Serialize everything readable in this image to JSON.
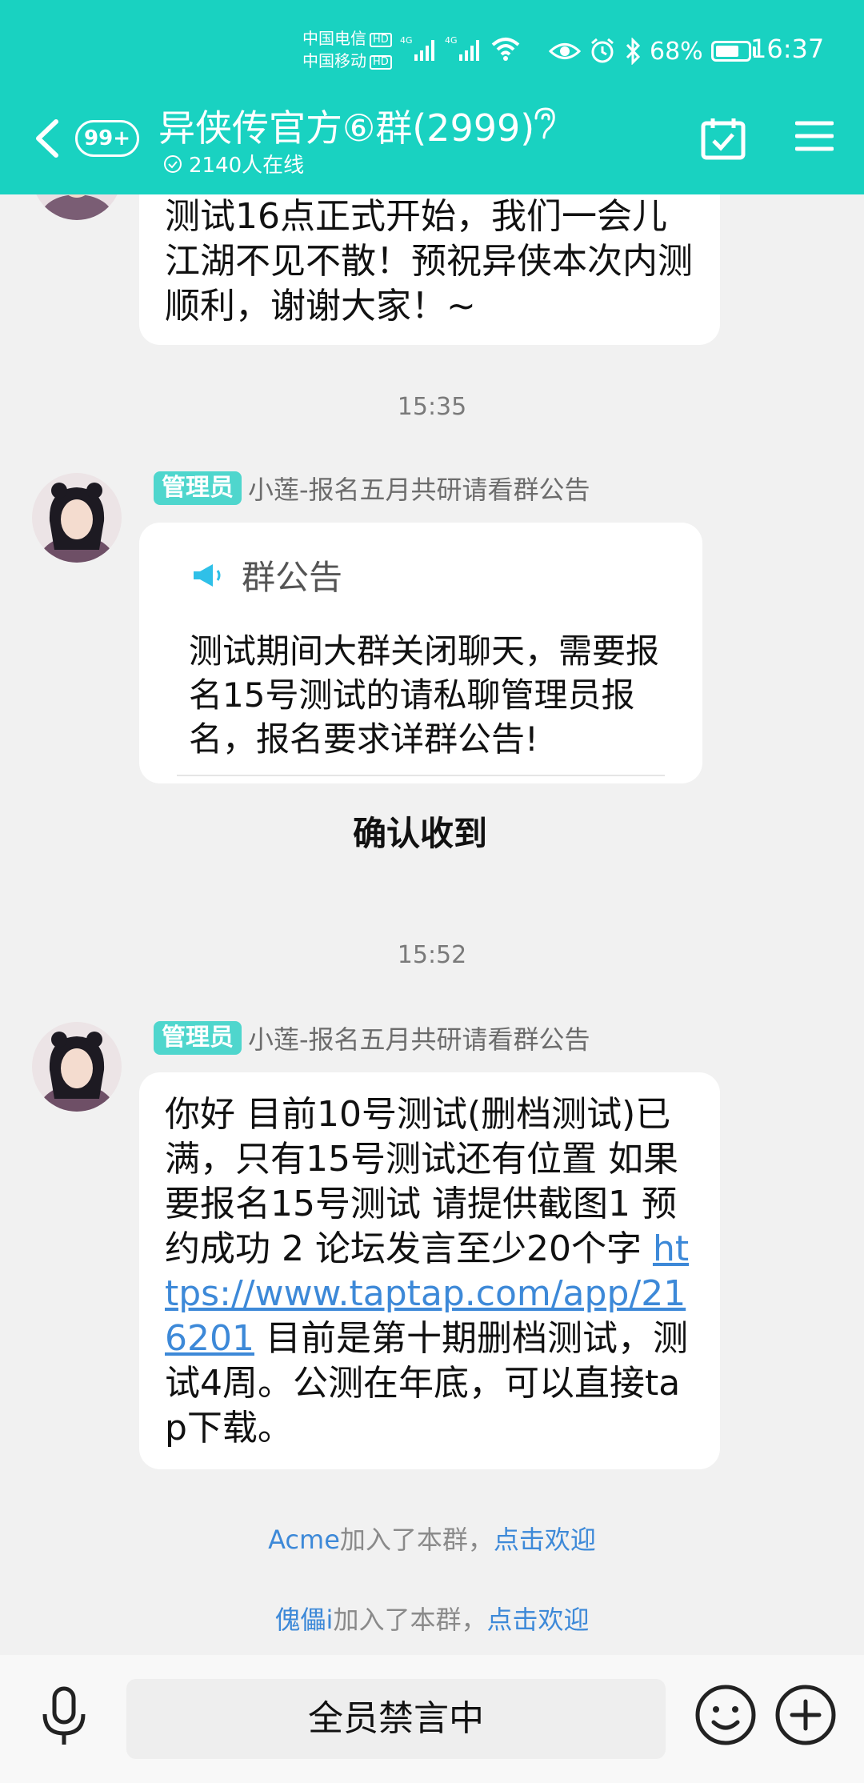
{
  "status_bar": {
    "carrier_1": "中国电信",
    "carrier_2": "中国移动",
    "hd": "HD",
    "network": "4G",
    "battery": "68%",
    "time": "16:37"
  },
  "header": {
    "unread_badge": "99+",
    "group_title": "异侠传官方⑥群(2999)",
    "online_count": "2140人在线"
  },
  "messages": [
    {
      "text": "测试16点正式开始，我们一会儿江湖不见不散！预祝异侠本次内测顺利，谢谢大家！~"
    },
    {
      "timestamp": "15:35"
    },
    {
      "role": "管理员",
      "sender": "小莲-报名五月共研请看群公告",
      "notice_title": "群公告",
      "notice_body": "测试期间大群关闭聊天，需要报名15号测试的请私聊管理员报名，报名要求详群公告!",
      "confirm_label": "确认收到"
    },
    {
      "timestamp": "15:52"
    },
    {
      "role": "管理员",
      "sender": "小莲-报名五月共研请看群公告",
      "text_before": "你好 目前10号测试(删档测试)已满，只有15号测试还有位置 如果要报名15号测试 请提供截图1 预约成功 2 论坛发言至少20个字 ",
      "link": "https://www.taptap.com/app/216201",
      "text_after": " 目前是第十期删档测试，测试4周。公测在年底，可以直接tap下载。"
    }
  ],
  "system": [
    {
      "user": "Acme",
      "joined": "加入了本群，",
      "action": "点击欢迎"
    },
    {
      "user": "傀儡i",
      "joined": "加入了本群，",
      "action": "点击欢迎"
    }
  ],
  "input_bar": {
    "muted_text": "全员禁言中"
  },
  "colors": {
    "header": "#19d2c1",
    "role_tag": "#4fd6cd",
    "link": "#3d89d8",
    "notice_icon": "#2fc0e8"
  }
}
